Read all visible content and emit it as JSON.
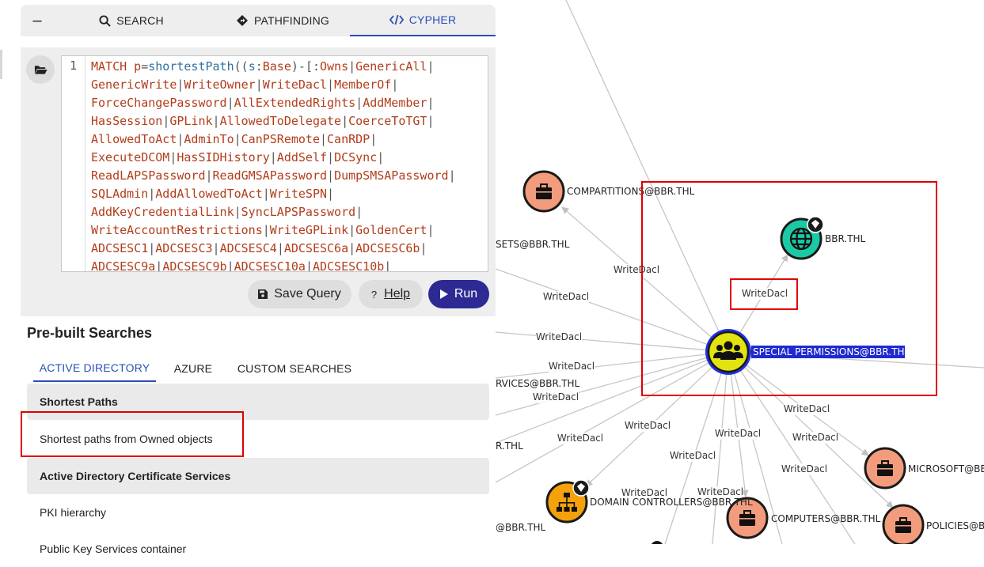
{
  "tabs": {
    "collapse_label": "–",
    "search": "SEARCH",
    "pathfinding": "PATHFINDING",
    "cypher": "CYPHER"
  },
  "editor": {
    "line_number": "1",
    "query_lines": [
      "MATCH p=shortestPath((s:Base)-[:Owns|GenericAll|",
      "GenericWrite|WriteOwner|WriteDacl|MemberOf|",
      "ForceChangePassword|AllExtendedRights|AddMember|",
      "HasSession|GPLink|AllowedToDelegate|CoerceToTGT|",
      "AllowedToAct|AdminTo|CanPSRemote|CanRDP|",
      "ExecuteDCOM|HasSIDHistory|AddSelf|DCSync|",
      "ReadLAPSPassword|ReadGMSAPassword|DumpSMSAPassword|",
      "SQLAdmin|AddAllowedToAct|WriteSPN|",
      "AddKeyCredentialLink|SyncLAPSPassword|",
      "WriteAccountRestrictions|WriteGPLink|GoldenCert|",
      "ADCSESC1|ADCSESC3|ADCSESC4|ADCSESC6a|ADCSESC6b|",
      "ADCSESC9a|ADCSESC9b|ADCSESC10a|ADCSESC10b|"
    ]
  },
  "buttons": {
    "save": "Save Query",
    "help_q": "?",
    "help": "Help",
    "run": "Run"
  },
  "prebuilt": {
    "title": "Pre-built Searches",
    "tabs": [
      "ACTIVE DIRECTORY",
      "AZURE",
      "CUSTOM SEARCHES"
    ],
    "sections": [
      {
        "header": "Shortest Paths",
        "items": [
          "Shortest paths from Owned objects"
        ]
      },
      {
        "header": "Active Directory Certificate Services",
        "items": [
          "PKI hierarchy",
          "Public Key Services container"
        ]
      }
    ]
  },
  "graph": {
    "nodes": [
      {
        "id": "special",
        "label": "SPECIAL PERMISSIONS@BBR.THL",
        "type": "group",
        "selected": true
      },
      {
        "id": "bbr",
        "label": "BBR.THL",
        "type": "domain",
        "tier_zero": true
      },
      {
        "id": "compartitions",
        "label": "COMPARTITIONS@BBR.THL",
        "type": "container"
      },
      {
        "id": "microsoft",
        "label": "MICROSOFT@BBR.THL",
        "type": "container"
      },
      {
        "id": "computers",
        "label": "COMPUTERS@BBR.THL",
        "type": "container"
      },
      {
        "id": "policies",
        "label": "POLICIES@BBR.THL",
        "type": "container"
      },
      {
        "id": "dc",
        "label": "DOMAIN CONTROLLERS@BBR.THL",
        "type": "ou",
        "tier_zero": true
      }
    ],
    "partial_labels": [
      "SETS@BBR.THL",
      "RVICES@BBR.THL",
      "R.THL",
      "@BBR.THL"
    ],
    "edge_label": "WriteDacl",
    "edge_label_count": 22
  },
  "colors": {
    "accent": "#2a4fb8",
    "run_button": "#2d2a93",
    "group_node": "#e3e30f",
    "domain_node": "#1bc9a5",
    "container_node": "#f29c7d",
    "ou_node": "#f4a10c",
    "highlight": "#e00000",
    "selected_label_bg": "#1f2ad0"
  }
}
